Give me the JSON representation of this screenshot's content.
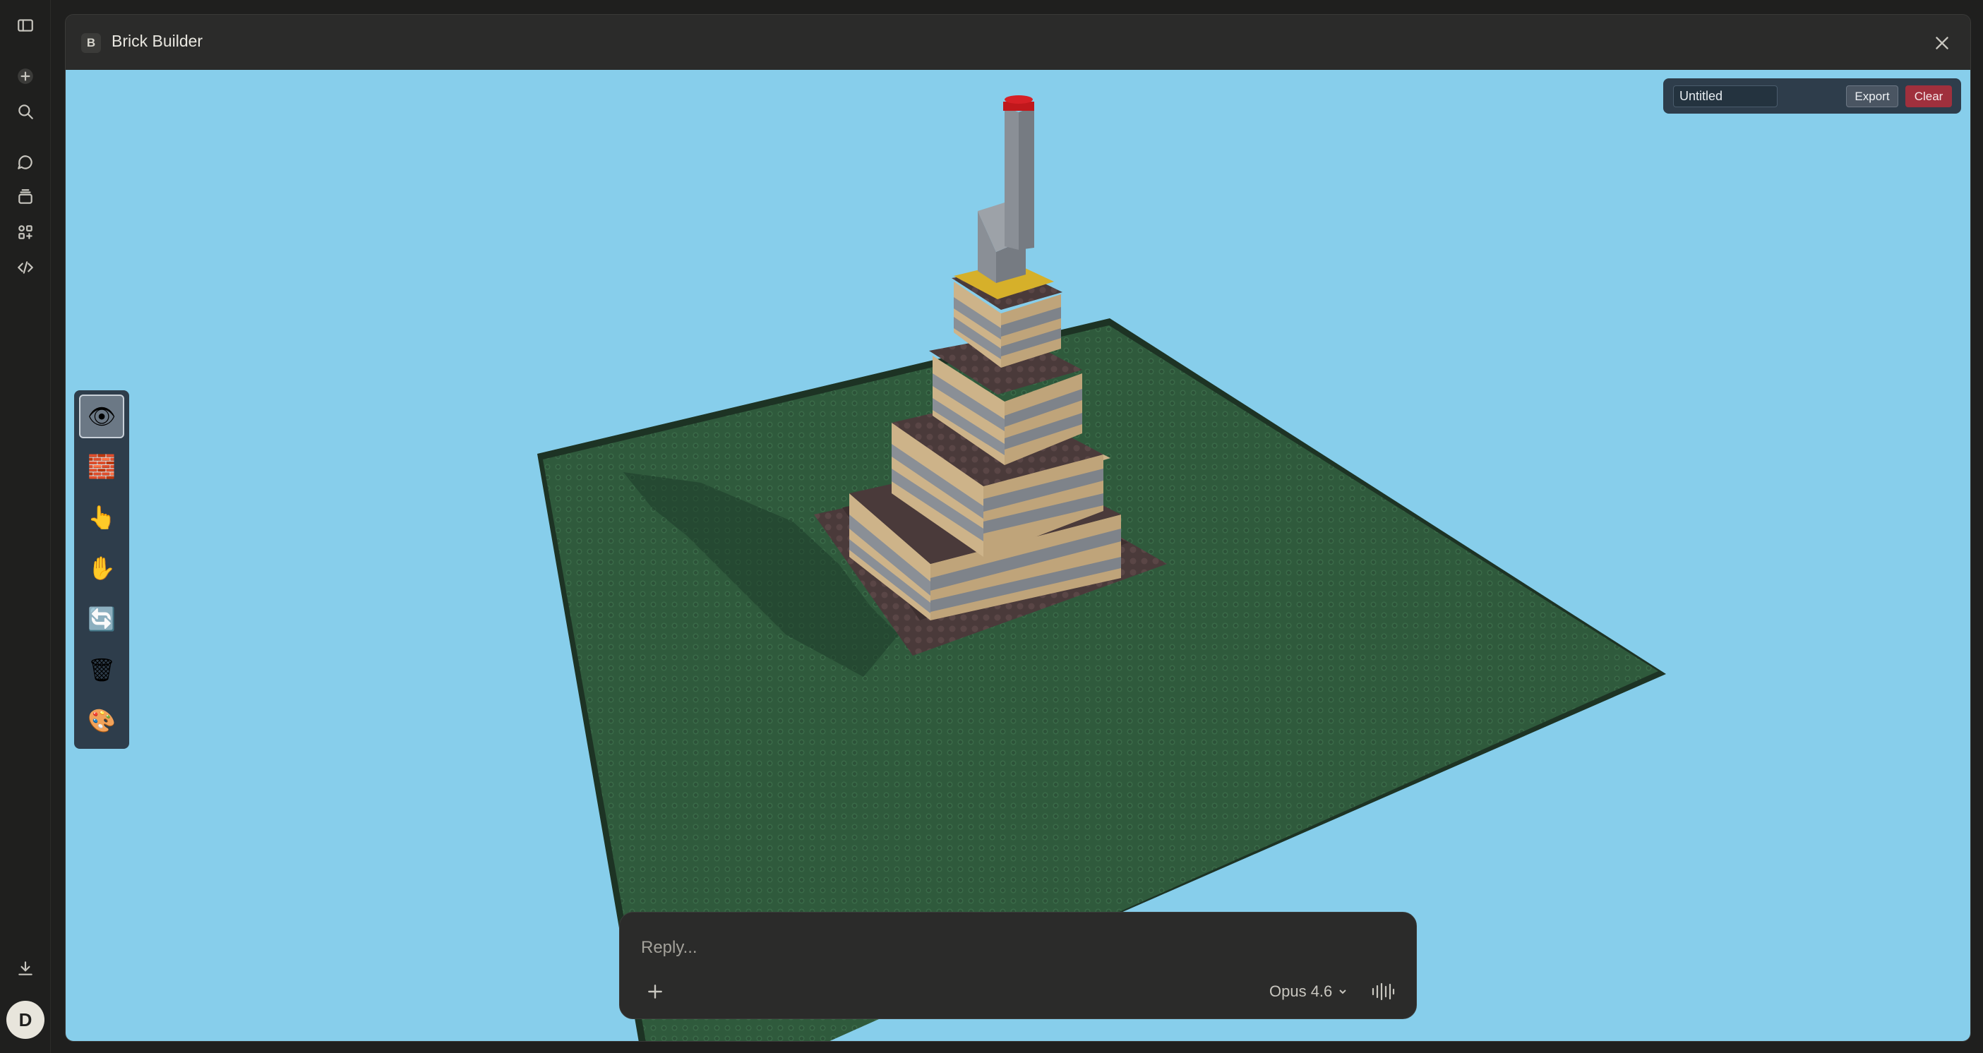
{
  "window": {
    "badge": "B",
    "title": "Brick Builder"
  },
  "toolbar": {
    "name_value": "Untitled",
    "export_label": "Export",
    "clear_label": "Clear"
  },
  "palette": {
    "tools": [
      {
        "name": "view",
        "glyph": "👁"
      },
      {
        "name": "build",
        "glyph": "🧱"
      },
      {
        "name": "select",
        "glyph": "👆"
      },
      {
        "name": "move",
        "glyph": "✋"
      },
      {
        "name": "rotate",
        "glyph": "🔄"
      },
      {
        "name": "delete",
        "glyph": "🗑"
      },
      {
        "name": "paint",
        "glyph": "🎨"
      }
    ],
    "active": "view"
  },
  "reply": {
    "placeholder": "Reply...",
    "model": "Opus 4.6"
  },
  "user": {
    "initial": "D"
  },
  "colors": {
    "sky": "#87ceeb",
    "baseplate": "#2f5a3c",
    "tan": "#cdb389",
    "gray": "#8a8f96",
    "dark_brown": "#4a3a3a",
    "yellow": "#d6b02a",
    "red": "#c0181c"
  }
}
